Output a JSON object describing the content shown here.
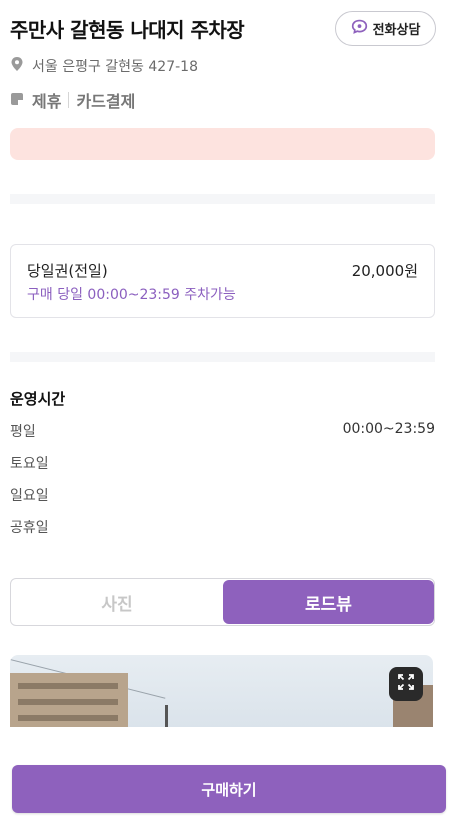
{
  "lot": {
    "name": "주만사 갈현동 나대지 주차장",
    "call_label": "전화상담",
    "address": "서울 은평구 갈현동 427-18",
    "tags": [
      "제휴",
      "카드결제"
    ]
  },
  "ticket": {
    "name": "당일권(전일)",
    "price": "20,000원",
    "description": "구매 당일 00:00~23:59 주차가능"
  },
  "hours": {
    "title": "운영시간",
    "rows": [
      {
        "day": "평일",
        "time": "00:00~23:59"
      },
      {
        "day": "토요일",
        "time": ""
      },
      {
        "day": "일요일",
        "time": ""
      },
      {
        "day": "공휴일",
        "time": ""
      }
    ]
  },
  "view_toggle": {
    "options": [
      "사진",
      "로드뷰"
    ],
    "selected": "로드뷰"
  },
  "purchase": {
    "label": "구매하기"
  },
  "icons": {
    "call": "chat-phone-icon",
    "address": "location-pin-icon",
    "tag": "card-tag-icon",
    "expand": "expand-icon"
  },
  "colors": {
    "accent": "#8e61bd",
    "notice_bg": "#fde3df",
    "ticket_desc": "#8b5fbf"
  }
}
